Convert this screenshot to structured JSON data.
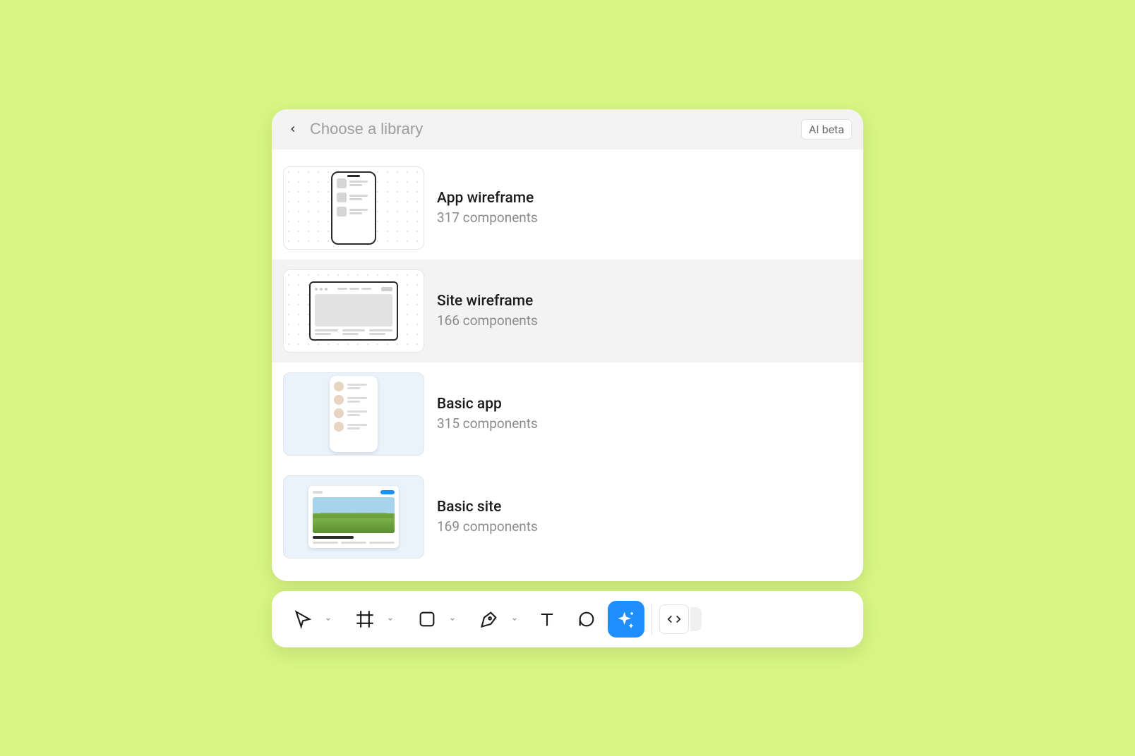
{
  "header": {
    "search_placeholder": "Choose a library",
    "badge": "AI beta"
  },
  "libraries": [
    {
      "title": "App wireframe",
      "subtitle": "317 components"
    },
    {
      "title": "Site wireframe",
      "subtitle": "166 components"
    },
    {
      "title": "Basic app",
      "subtitle": "315 components"
    },
    {
      "title": "Basic site",
      "subtitle": "169 components"
    }
  ],
  "toolbar": {
    "tools": [
      {
        "name": "move-tool",
        "has_chevron": true
      },
      {
        "name": "frame-tool",
        "has_chevron": true
      },
      {
        "name": "shape-tool",
        "has_chevron": true
      },
      {
        "name": "pen-tool",
        "has_chevron": true
      },
      {
        "name": "text-tool",
        "has_chevron": false
      },
      {
        "name": "comment-tool",
        "has_chevron": false
      },
      {
        "name": "ai-tool",
        "has_chevron": false,
        "active": true
      }
    ]
  }
}
